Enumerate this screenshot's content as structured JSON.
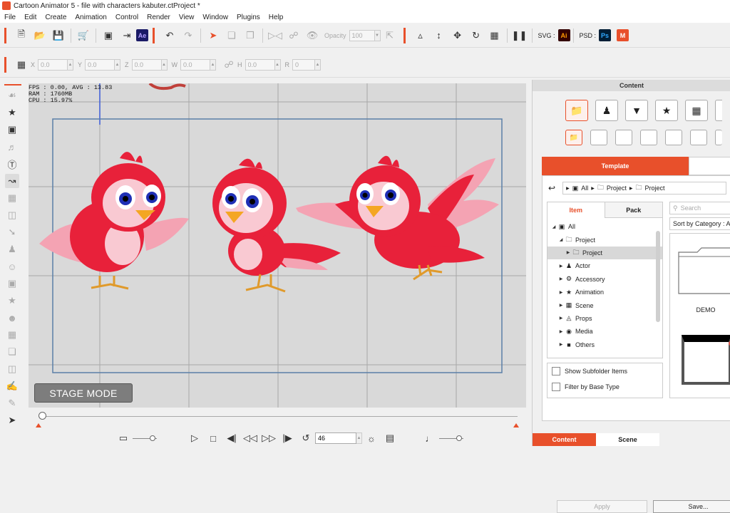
{
  "window": {
    "title": "Cartoon Animator 5 - file with characters kabuter.ctProject *"
  },
  "menu": [
    "File",
    "Edit",
    "Create",
    "Animation",
    "Control",
    "Render",
    "View",
    "Window",
    "Plugins",
    "Help"
  ],
  "toolbar": {
    "opacity_label": "Opacity",
    "opacity_value": "100",
    "svg_label": "SVG :",
    "psd_label": "PSD :",
    "ae_badge": "Ae",
    "ai_badge": "Ai",
    "ps_badge": "Ps"
  },
  "transform": {
    "x_label": "X",
    "x_value": "0.0",
    "y_label": "Y",
    "y_value": "0.0",
    "z_label": "Z",
    "z_value": "0.0",
    "w_label": "W",
    "w_value": "0.0",
    "h_label": "H",
    "h_value": "0.0",
    "r_label": "R",
    "r_value": "0"
  },
  "stage": {
    "stats": "FPS : 0.00, AVG : 13.83\nRAM : 1760MB\nCPU : 15.97%",
    "mode_button": "STAGE MODE"
  },
  "timeline": {
    "frame_value": "46"
  },
  "content_panel": {
    "header": "Content",
    "tab_template": "Template",
    "path": [
      "All",
      "Project",
      "Project"
    ],
    "tab_item": "Item",
    "tab_pack": "Pack",
    "tree": [
      {
        "label": "All",
        "level": 0,
        "expanded": true
      },
      {
        "label": "Project",
        "level": 1,
        "expanded": true
      },
      {
        "label": "Project",
        "level": 2,
        "expanded": false,
        "selected": true
      },
      {
        "label": "Actor",
        "level": 1,
        "expanded": false
      },
      {
        "label": "Accessory",
        "level": 1,
        "expanded": false
      },
      {
        "label": "Animation",
        "level": 1,
        "expanded": false
      },
      {
        "label": "Scene",
        "level": 1,
        "expanded": false
      },
      {
        "label": "Props",
        "level": 1,
        "expanded": false
      },
      {
        "label": "Media",
        "level": 1,
        "expanded": false
      },
      {
        "label": "Others",
        "level": 1,
        "expanded": false
      }
    ],
    "show_subfolder": "Show Subfolder Items",
    "filter_base": "Filter by Base Type",
    "search_placeholder": "Search",
    "sort_label": "Sort by Category : A t",
    "demo_label": "DEMO",
    "apply_button": "Apply",
    "save_button": "Save...",
    "bottom_tab_content": "Content",
    "bottom_tab_scene": "Scene"
  },
  "colors": {
    "accent": "#e8502b",
    "bird_red": "#e8213a",
    "bird_pink": "#f7b6c2"
  }
}
